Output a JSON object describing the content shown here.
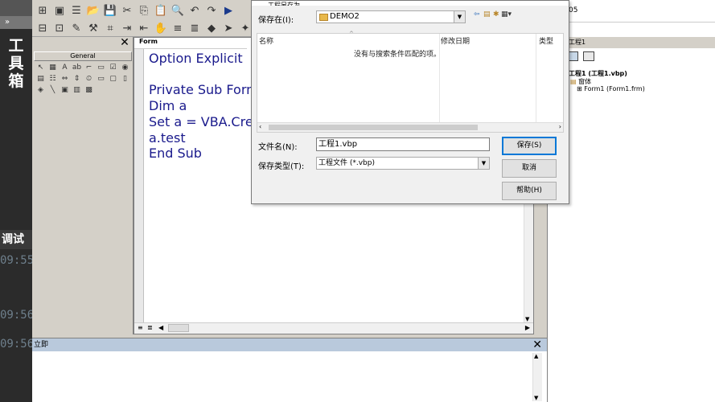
{
  "left_strip": {
    "toolbox_title": [
      "工",
      "具",
      "箱"
    ],
    "debug_title": "调试",
    "times": [
      "09:55",
      "09:56",
      "09:56"
    ]
  },
  "toolbox": {
    "tab_label": "General",
    "close": "✕"
  },
  "code": {
    "header": "Form",
    "lines": [
      "Option Explicit",
      "",
      "Private Sub Form_",
      "Dim a",
      "Set a = VBA.Creat",
      "a.test",
      "End Sub"
    ]
  },
  "project": {
    "title": "工程1",
    "tree": [
      "工程1 (工程1.vbp)",
      "窗体",
      "Form1 (Form1.frm)"
    ],
    "top_value": "05"
  },
  "immediate": {
    "title": "立即",
    "close": "✕"
  },
  "dialog": {
    "title": "工程另存为",
    "save_in_label": "保存在(I):",
    "save_in_value": "DEMO2",
    "columns": [
      "名称",
      "修改日期",
      "类型"
    ],
    "empty_message": "没有与搜索条件匹配的项。",
    "filename_label": "文件名(N):",
    "filename_value": "工程1.vbp",
    "filetype_label": "保存类型(T):",
    "filetype_value": "工程文件 (*.vbp)",
    "save_button": "保存(S)",
    "cancel_button": "取消",
    "help_button": "帮助(H)"
  }
}
